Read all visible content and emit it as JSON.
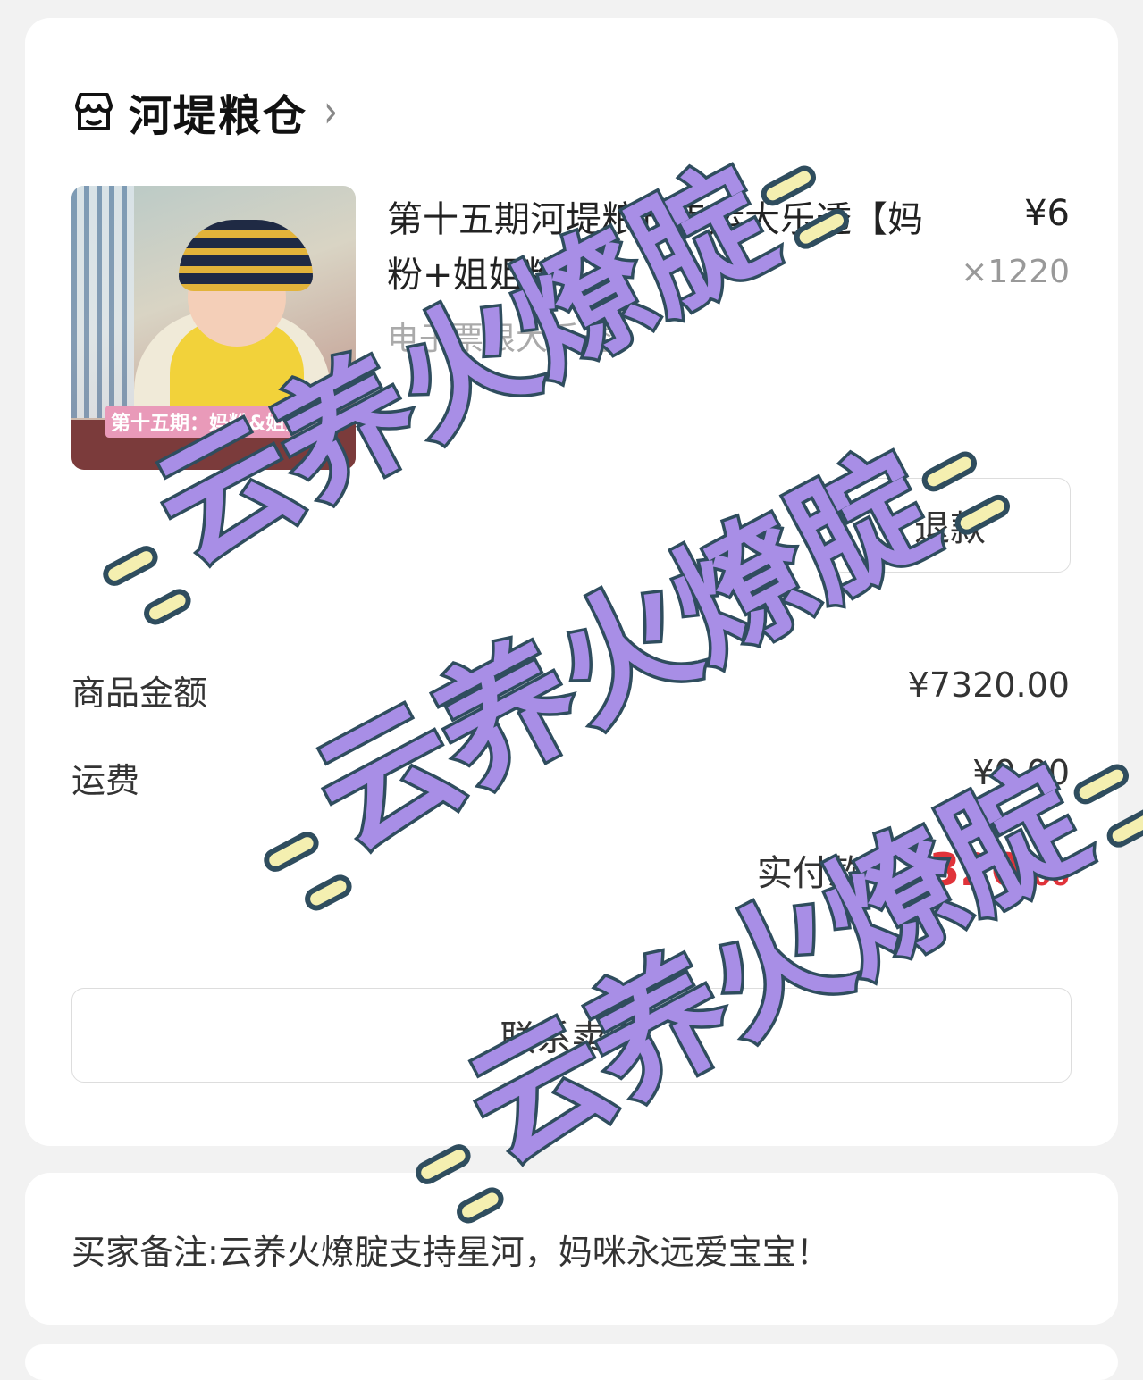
{
  "shop": {
    "name": "河堤粮仓",
    "icon": "store-icon"
  },
  "item": {
    "title": "第十五期河堤粮仓幸运大乐透【妈粉+姐姐粉】",
    "subtitle": "电子票根大乐透",
    "price": "¥6",
    "quantity": "×1220",
    "image_caption": "第十五期：妈粉&姐姐粉"
  },
  "actions": {
    "refund": "退款",
    "contact": "联系卖家"
  },
  "summary": {
    "goods_label": "商品金额",
    "goods_value": "¥7320.00",
    "shipping_label": "运费",
    "shipping_value": "¥0.00",
    "paid_label": "实付款",
    "paid_symbol": "¥",
    "paid_int": "7320",
    "paid_dec": ".00"
  },
  "note": {
    "text": "买家备注:云养火燎腚支持星河，妈咪永远爱宝宝！"
  },
  "watermark": {
    "text": "云养火燎腚"
  },
  "colors": {
    "accent_red": "#e0333a",
    "watermark_fill": "#a88ee6",
    "watermark_stroke": "#2f4d5e"
  }
}
